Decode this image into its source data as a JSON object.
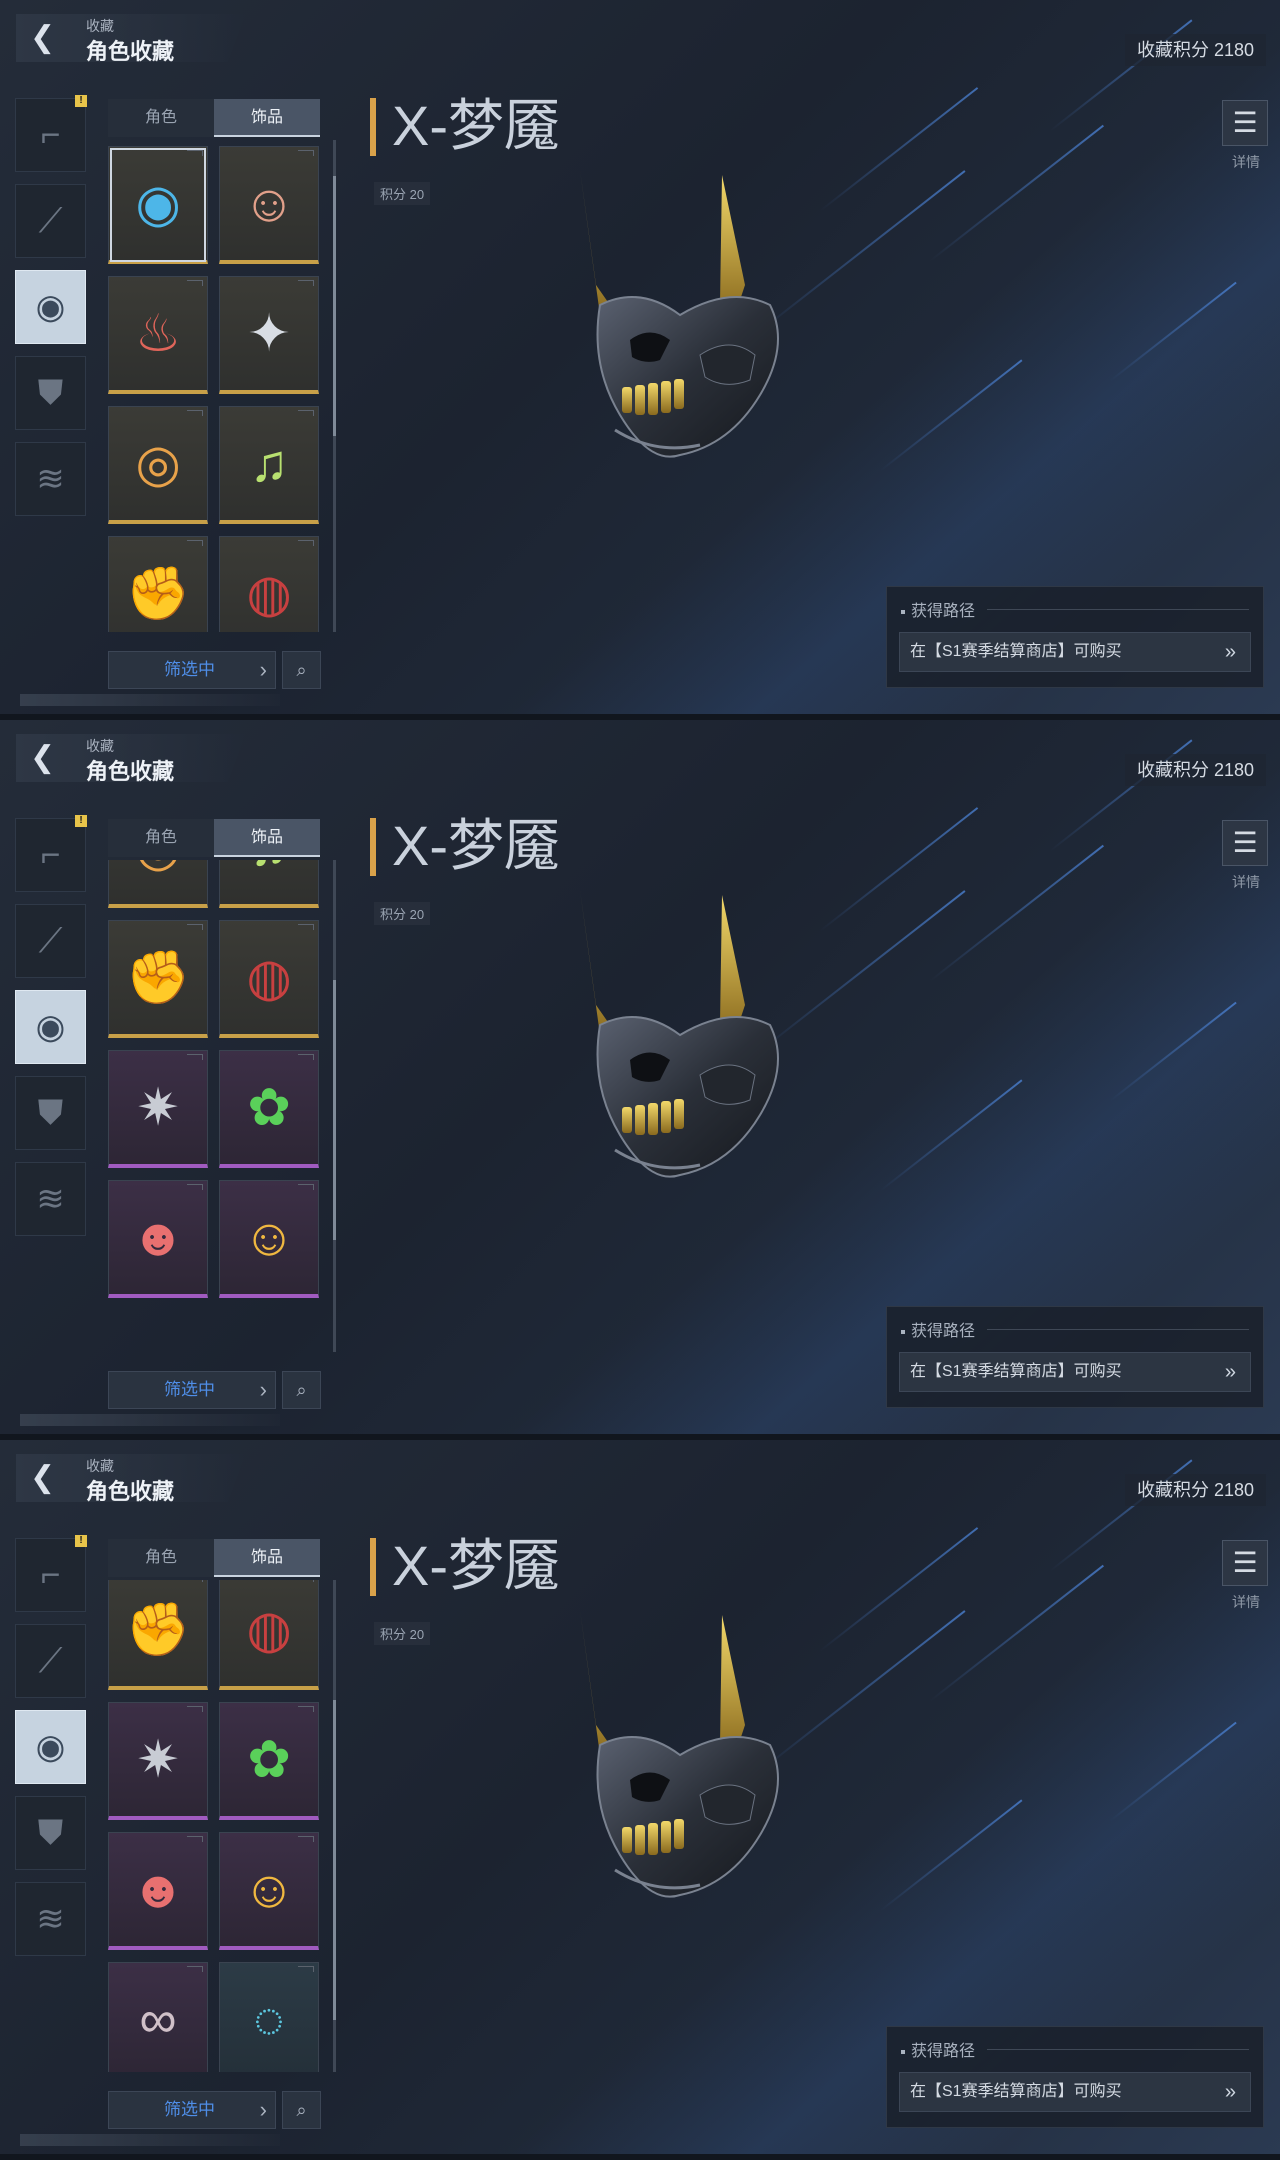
{
  "header": {
    "crumb_small": "收藏",
    "crumb_title": "角色收藏",
    "points_total": "收藏积分 2180"
  },
  "tabs": [
    {
      "label": "角色"
    },
    {
      "label": "饰品"
    }
  ],
  "categories": [
    {
      "icon": "pistol-icon",
      "alert": "!"
    },
    {
      "icon": "melee-icon"
    },
    {
      "icon": "mask-icon"
    },
    {
      "icon": "armor-icon"
    },
    {
      "icon": "glider-icon"
    }
  ],
  "item": {
    "name": "X-梦魇",
    "points": "积分 20",
    "detail_label": "详情"
  },
  "acquire": {
    "title": "获得路径",
    "method": "在【S1赛季结算商店】可购买"
  },
  "filter": {
    "label": "筛选中"
  },
  "colors": {
    "accent_gold": "#c8a048",
    "accent_purple": "#a15bc0",
    "accent_teal": "#4aa6c0",
    "filter_blue": "#4f8ee8"
  },
  "screens": [
    {
      "scroll": "top",
      "tiles": [
        "mask-icon",
        "girl-head-icon",
        "pig-icon",
        "wolf-icon",
        "ufo-pig-icon",
        "cat-headphones-icon",
        "gauntlet-icon",
        "drone-eye-icon"
      ]
    },
    {
      "scroll": "middle",
      "tiles": [
        "ufo-pig-icon",
        "cat-headphones-icon",
        "gauntlet-icon",
        "drone-eye-icon",
        "robot-head-icon",
        "green-pig-icon",
        "pilot-pig-icon",
        "smiley-icon"
      ]
    },
    {
      "scroll": "bottom",
      "tiles": [
        "gauntlet-icon",
        "drone-eye-icon",
        "robot-head-icon",
        "green-pig-icon",
        "pilot-pig-icon",
        "smiley-icon",
        "glasses-icon",
        "cyber-ring-icon"
      ]
    }
  ]
}
